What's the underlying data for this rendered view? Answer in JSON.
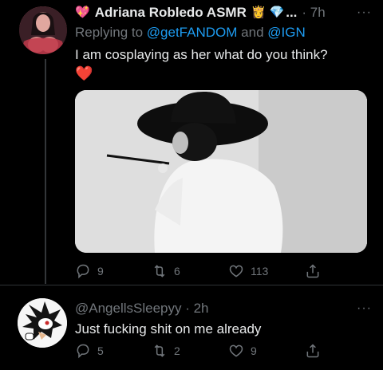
{
  "tweet1": {
    "display_name": "Adriana Robledo ASMR",
    "emojis": [
      "💖",
      "👸",
      "💎"
    ],
    "truncated": "...",
    "time": "· 7h",
    "more": "···",
    "reply_prefix": "Replying to",
    "reply_handle_1": "@getFANDOM",
    "reply_and": "and",
    "reply_handle_2": "@IGN",
    "text": "I am cosplaying as her what do you think?",
    "text_emoji": "❤️",
    "actions": {
      "replies": "9",
      "retweets": "6",
      "likes": "113"
    }
  },
  "tweet2": {
    "handle_time": "@AngellsSleepyy · 2h",
    "more": "···",
    "text": "Just fucking shit on me already",
    "actions": {
      "replies": "5",
      "retweets": "2",
      "likes": "9"
    }
  }
}
